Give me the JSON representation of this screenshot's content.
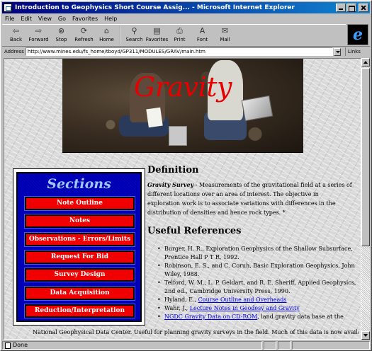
{
  "window": {
    "title": "Introduction to Geophysics Short Course Assig... - Microsoft Internet Explorer"
  },
  "menu": [
    "File",
    "Edit",
    "View",
    "Go",
    "Favorites",
    "Help"
  ],
  "toolbar": {
    "buttons": [
      {
        "label": "Back",
        "icon": "back-arrow-icon"
      },
      {
        "label": "Forward",
        "icon": "forward-arrow-icon"
      },
      {
        "label": "Stop",
        "icon": "stop-icon"
      },
      {
        "label": "Refresh",
        "icon": "refresh-icon"
      },
      {
        "label": "Home",
        "icon": "home-icon"
      },
      {
        "label": "Search",
        "icon": "search-icon"
      },
      {
        "label": "Favorites",
        "icon": "favorites-icon"
      },
      {
        "label": "Print",
        "icon": "print-icon"
      },
      {
        "label": "Font",
        "icon": "font-icon"
      },
      {
        "label": "Mail",
        "icon": "mail-icon"
      }
    ]
  },
  "address": {
    "label": "Address",
    "value": "http://www.mines.edu/fs_home/tboyd/GP311/MODULES/GRAV/main.htm",
    "links_label": "Links"
  },
  "banner": {
    "title": "Gravity"
  },
  "sections": {
    "title": "Sections",
    "items": [
      "Note Outline",
      "Notes",
      "Observations - Errors/Limits",
      "Request For Bid",
      "Survey Design",
      "Data Acquisition",
      "Reduction/Interpretation"
    ]
  },
  "definition": {
    "heading": "Definition",
    "term": "Gravity Survey",
    "text": " - Measurements of the gravitational field at a series of different locations over an area of interest. The objective in exploration work is to associate variations with differences in the distribution of densities and hence rock types. *"
  },
  "references": {
    "heading": "Useful References",
    "items": [
      {
        "text": "Burger, H. R., Exploration Geophysics of the Shallow Subsurface, Prentice Hall P T R, 1992.",
        "link": ""
      },
      {
        "text": "Robinson, E. S., and C. Coruh, Basic Exploration Geophysics, John Wiley, 1988.",
        "link": ""
      },
      {
        "text": "Telford, W. M., L. P. Geldart, and R. E. Sheriff, Applied Geophysics, 2nd ed., Cambridge University Press, 1990.",
        "link": ""
      },
      {
        "text": "Hyland, E., ",
        "link": "Course Outline and Overheads"
      },
      {
        "text": "Wahr, J., ",
        "link": "Lecture Notes in Geodesy and Gravity"
      },
      {
        "text": "",
        "link": "NGDC Gravity Data on CD-ROM",
        "after": ", land gravity data base at the"
      }
    ]
  },
  "bottom_text": "National Geophysical Data Center. Useful for planning gravity surveys in the field. Much of this data is now available",
  "status": {
    "text": "Done"
  }
}
